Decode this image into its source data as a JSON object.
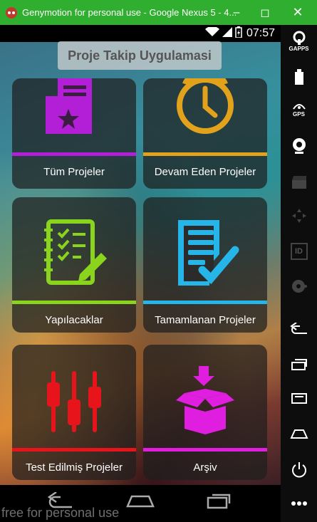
{
  "window": {
    "title": "Genymotion for personal use - Google Nexus 5 - 4..."
  },
  "statusbar": {
    "time": "07:57"
  },
  "app": {
    "title": "Proje Takip Uygulamasi"
  },
  "cards": [
    {
      "label": "Tüm Projeler",
      "color": "#b21fd6",
      "icon": "folder-star-icon"
    },
    {
      "label": "Devam Eden Projeler",
      "color": "#e2a21c",
      "icon": "alarm-clock-icon"
    },
    {
      "label": "Yapılacaklar",
      "color": "#8ad41e",
      "icon": "checklist-icon"
    },
    {
      "label": "Tamamlanan Projeler",
      "color": "#26b5e8",
      "icon": "document-check-icon"
    },
    {
      "label": "Test Edilmiş Projeler",
      "color": "#e8141c",
      "icon": "sliders-icon"
    },
    {
      "label": "Arşiv",
      "color": "#e01ee0",
      "icon": "archive-box-icon"
    }
  ],
  "watermark": "free for personal use",
  "panel": {
    "gaps_label": "GAPPS",
    "gps_label": "GPS",
    "id_label": "ID"
  }
}
